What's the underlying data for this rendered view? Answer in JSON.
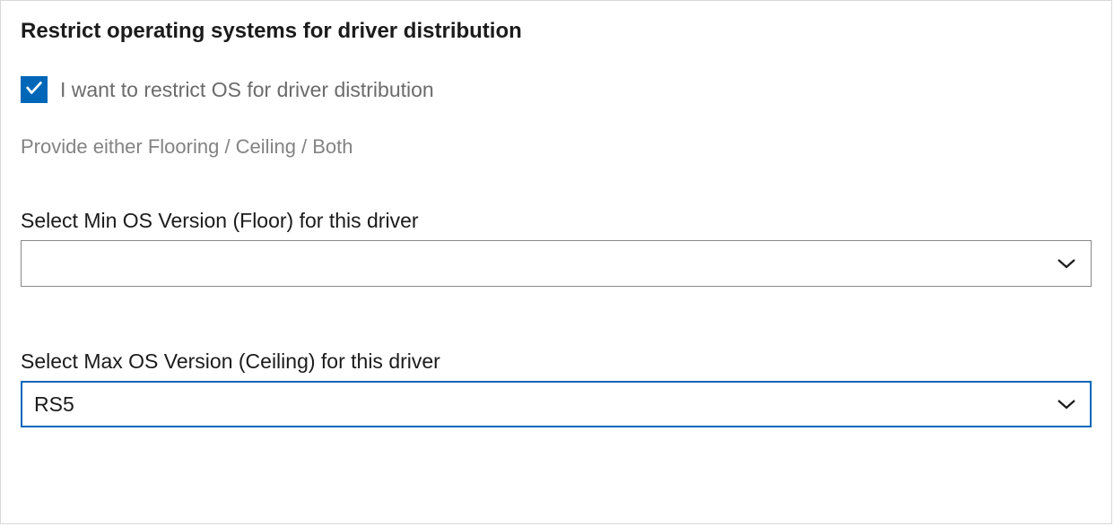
{
  "heading": "Restrict operating systems for driver distribution",
  "checkbox": {
    "label": "I want to restrict OS for driver distribution",
    "checked": true
  },
  "helper": "Provide either Flooring / Ceiling / Both",
  "minOs": {
    "label": "Select Min OS Version (Floor) for this driver",
    "value": ""
  },
  "maxOs": {
    "label": "Select Max OS Version (Ceiling) for this driver",
    "value": "RS5"
  }
}
